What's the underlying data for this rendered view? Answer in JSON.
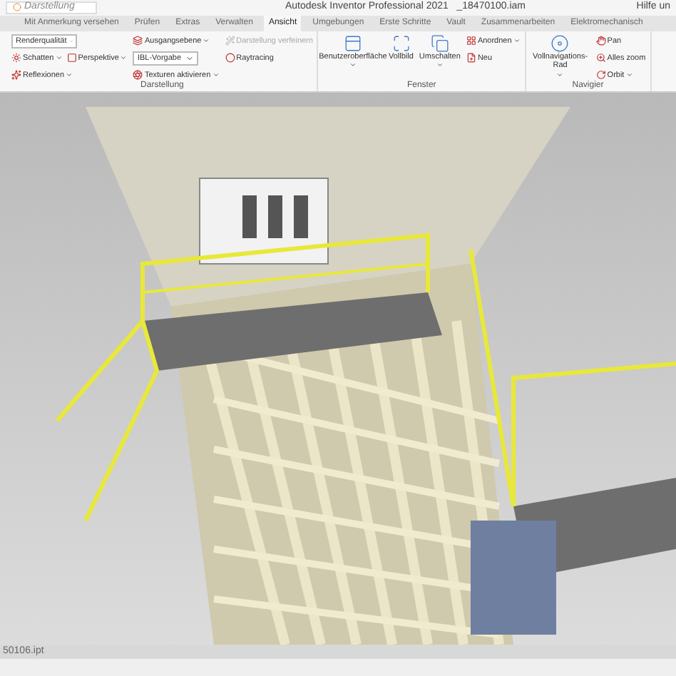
{
  "title_bar": {
    "quick_access_field": "Darstellung",
    "title": "Autodesk Inventor Professional 2021   _18470100.iam",
    "help": "Hilfe un"
  },
  "tabs": [
    {
      "label": "Mit Anmerkung versehen",
      "selected": false
    },
    {
      "label": "Prüfen",
      "selected": false
    },
    {
      "label": "Extras",
      "selected": false
    },
    {
      "label": "Verwalten",
      "selected": false
    },
    {
      "label": "Ansicht",
      "selected": true
    },
    {
      "label": "Umgebungen",
      "selected": false
    },
    {
      "label": "Erste Schritte",
      "selected": false
    },
    {
      "label": "Vault",
      "selected": false
    },
    {
      "label": "Zusammenarbeiten",
      "selected": false
    },
    {
      "label": "Elektromechanisch",
      "selected": false
    }
  ],
  "panels": [
    {
      "title": "Darstellung",
      "columns": [
        [
          [
            {
              "kind": "select",
              "label": "Renderqualität",
              "disabled": false
            }
          ],
          [
            {
              "kind": "small",
              "label": "Schatten",
              "dropdown": true,
              "disabled": false
            },
            {
              "kind": "small",
              "label": "Perspektive",
              "dropdown": true,
              "disabled": false
            }
          ],
          [
            {
              "kind": "small",
              "label": "Reflexionen",
              "dropdown": true,
              "disabled": false
            }
          ]
        ],
        [
          [
            {
              "kind": "small",
              "label": "Ausgangsebene",
              "dropdown": true,
              "disabled": false
            }
          ],
          [
            {
              "kind": "select",
              "label": "IBL-Vorgabe",
              "disabled": false
            }
          ],
          [
            {
              "kind": "small",
              "label": "Texturen aktivieren",
              "dropdown": true,
              "disabled": false
            }
          ]
        ],
        [
          [
            {
              "kind": "small",
              "label": "Darstellung verfeinern",
              "dropdown": false,
              "disabled": true
            }
          ],
          [
            {
              "kind": "small",
              "label": "Raytracing",
              "dropdown": false,
              "disabled": false
            }
          ]
        ]
      ]
    },
    {
      "title": "Fenster",
      "columns": [
        [
          [
            {
              "kind": "large",
              "label": "Benutzeroberfläche",
              "dropdown": true,
              "disabled": false
            }
          ]
        ],
        [
          [
            {
              "kind": "large",
              "label": "Vollbild",
              "dropdown": false,
              "disabled": false
            }
          ]
        ],
        [
          [
            {
              "kind": "large",
              "label": "Umschalten",
              "dropdown": true,
              "disabled": false
            }
          ]
        ],
        [
          [
            {
              "kind": "small",
              "label": "Anordnen",
              "dropdown": true,
              "disabled": false
            }
          ],
          [
            {
              "kind": "small",
              "label": "Neu",
              "dropdown": false,
              "disabled": false
            }
          ]
        ]
      ]
    },
    {
      "title": "Navigier",
      "columns": [
        [
          [
            {
              "kind": "large",
              "label": "Vollnavigations-Rad",
              "dropdown": true,
              "disabled": false
            }
          ]
        ],
        [
          [
            {
              "kind": "small",
              "label": "Pan",
              "dropdown": false,
              "disabled": false
            }
          ],
          [
            {
              "kind": "small",
              "label": "Alles zoom",
              "dropdown": false,
              "disabled": false
            }
          ],
          [
            {
              "kind": "small",
              "label": "Orbit",
              "dropdown": true,
              "disabled": false
            }
          ]
        ]
      ]
    }
  ],
  "document_tab": {
    "label": "50106.ipt"
  }
}
